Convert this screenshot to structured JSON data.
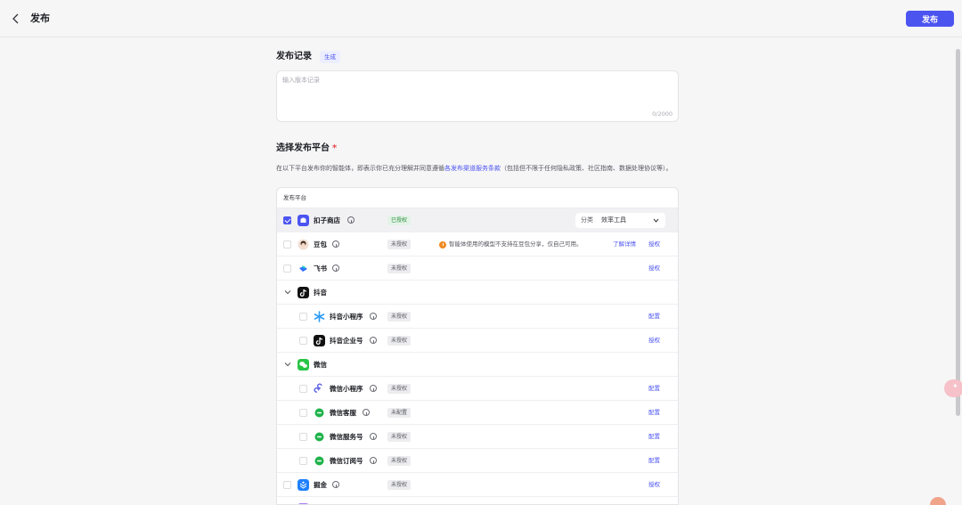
{
  "header": {
    "title": "发布",
    "publish_label": "发布"
  },
  "record": {
    "title": "发布记录",
    "generate_label": "生成",
    "placeholder": "输入版本记录",
    "value": "",
    "count": "0/2000"
  },
  "platform": {
    "title": "选择发布平台",
    "required_mark": "*",
    "desc_before": "在以下平台发布你的智能体，即表示你已充分理解并同意遵循",
    "desc_link": "各发布渠道服务条款",
    "desc_after": "（包括但不限于任何隐私政策、社区指南、数据处理协议等）。",
    "table_header": "发布平台"
  },
  "rows": {
    "kouzi": {
      "name": "扣子商店",
      "status": "已授权",
      "category_label": "分类",
      "category_value": "效率工具",
      "checked": true
    },
    "doubao": {
      "name": "豆包",
      "status": "未授权",
      "warning": "智能体使用的模型不支持在豆包分享，仅自己可用。",
      "warning_link": "了解详情",
      "action": "授权"
    },
    "feishu": {
      "name": "飞书",
      "status": "未授权",
      "action": "授权"
    },
    "douyin": {
      "name": "抖音"
    },
    "douyin_mini": {
      "name": "抖音小程序",
      "status": "未授权",
      "action": "配置"
    },
    "douyin_biz": {
      "name": "抖音企业号",
      "status": "未授权",
      "action": "授权"
    },
    "wechat": {
      "name": "微信"
    },
    "wechat_mini": {
      "name": "微信小程序",
      "status": "未授权",
      "action": "配置"
    },
    "wechat_kf": {
      "name": "微信客服",
      "status": "未配置",
      "action": "配置"
    },
    "wechat_service": {
      "name": "微信服务号",
      "status": "未授权",
      "action": "配置"
    },
    "wechat_sub": {
      "name": "微信订阅号",
      "status": "未授权",
      "action": "配置"
    },
    "juejin": {
      "name": "掘金",
      "status": "未授权",
      "action": "授权"
    }
  },
  "colors": {
    "accent": "#4c54f0",
    "authorized": "#2e8a42",
    "warning": "#f08a24"
  }
}
